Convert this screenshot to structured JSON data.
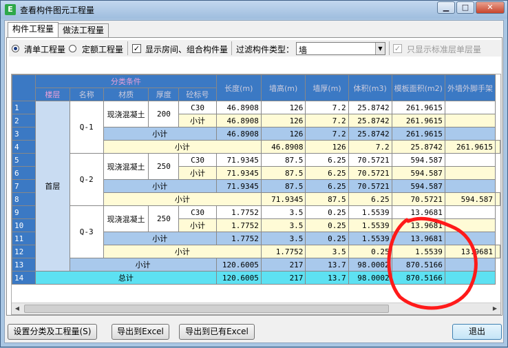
{
  "window": {
    "title": "查看构件图元工程量",
    "app_icon": "app-icon"
  },
  "tabs": [
    {
      "label": "构件工程量",
      "active": true
    },
    {
      "label": "做法工程量",
      "active": false
    }
  ],
  "options": {
    "radio_list": "清单工程量",
    "radio_quota": "定额工程量",
    "show_rooms_label": "显示房间、组合构件量",
    "show_rooms_checked": true,
    "filter_label": "过滤构件类型：",
    "filter_value": "墙",
    "std_floor_label": "只显示标准层单层量",
    "std_floor_checked": true,
    "std_floor_disabled": true
  },
  "table": {
    "group_header": "分类条件",
    "headers": [
      "楼层",
      "名称",
      "材质",
      "厚度",
      "砼标号",
      "长度(m)",
      "墙高(m)",
      "墙厚(m)",
      "体积(m3)",
      "模板面积(m2)",
      "外墙外脚手架"
    ],
    "floor": "首层",
    "rows": [
      {
        "n": "1",
        "cells": [
          "46.8908",
          "126",
          "7.2",
          "25.8742",
          "261.9615"
        ]
      },
      {
        "n": "2",
        "cells": [
          "46.8908",
          "126",
          "7.2",
          "25.8742",
          "261.9615"
        ]
      },
      {
        "n": "3",
        "cells": [
          "46.8908",
          "126",
          "7.2",
          "25.8742",
          "261.9615"
        ]
      },
      {
        "n": "4",
        "cells": [
          "46.8908",
          "126",
          "7.2",
          "25.8742",
          "261.9615"
        ]
      },
      {
        "n": "5",
        "cells": [
          "71.9345",
          "87.5",
          "6.25",
          "70.5721",
          "594.587"
        ]
      },
      {
        "n": "6",
        "cells": [
          "71.9345",
          "87.5",
          "6.25",
          "70.5721",
          "594.587"
        ]
      },
      {
        "n": "7",
        "cells": [
          "71.9345",
          "87.5",
          "6.25",
          "70.5721",
          "594.587"
        ]
      },
      {
        "n": "8",
        "cells": [
          "71.9345",
          "87.5",
          "6.25",
          "70.5721",
          "594.587"
        ]
      },
      {
        "n": "9",
        "cells": [
          "1.7752",
          "3.5",
          "0.25",
          "1.5539",
          "13.9681"
        ]
      },
      {
        "n": "10",
        "cells": [
          "1.7752",
          "3.5",
          "0.25",
          "1.5539",
          "13.9681"
        ]
      },
      {
        "n": "11",
        "cells": [
          "1.7752",
          "3.5",
          "0.25",
          "1.5539",
          "13.9681"
        ]
      },
      {
        "n": "12",
        "cells": [
          "1.7752",
          "3.5",
          "0.25",
          "1.5539",
          "13.9681"
        ]
      },
      {
        "n": "13",
        "cells": [
          "120.6005",
          "217",
          "13.7",
          "98.0002",
          "870.5166"
        ]
      },
      {
        "n": "14",
        "cells": [
          "120.6005",
          "217",
          "13.7",
          "98.0002",
          "870.5166"
        ]
      }
    ],
    "groups": [
      {
        "name": "Q-1",
        "material": "现浇混凝土",
        "thickness": "200",
        "grade": "C30"
      },
      {
        "name": "Q-2",
        "material": "现浇混凝土",
        "thickness": "250",
        "grade": "C30"
      },
      {
        "name": "Q-3",
        "material": "现浇混凝土",
        "thickness": "250",
        "grade": "C30"
      }
    ],
    "subtotal": "小计",
    "total": "总计"
  },
  "buttons": {
    "set_class": "设置分类及工程量(S)",
    "export_excel": "导出到Excel",
    "export_existing": "导出到已有Excel",
    "exit": "退出"
  },
  "annotation": {
    "color": "#ff1a1a"
  }
}
